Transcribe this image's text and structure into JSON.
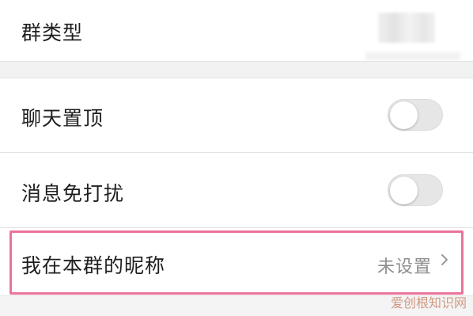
{
  "rows": {
    "group_type": {
      "label": "群类型"
    },
    "pin_chat": {
      "label": "聊天置顶",
      "toggle_on": false
    },
    "mute_notifications": {
      "label": "消息免打扰",
      "toggle_on": false
    },
    "group_nickname": {
      "label": "我在本群的昵称",
      "value": "未设置"
    }
  },
  "watermark": "爱创根知识网",
  "colors": {
    "highlight_border": "#e9749b",
    "toggle_off_track": "#e6e6e6",
    "secondary_text": "#8e8e8e"
  },
  "icons": {
    "chevron": "chevron-right-icon"
  }
}
